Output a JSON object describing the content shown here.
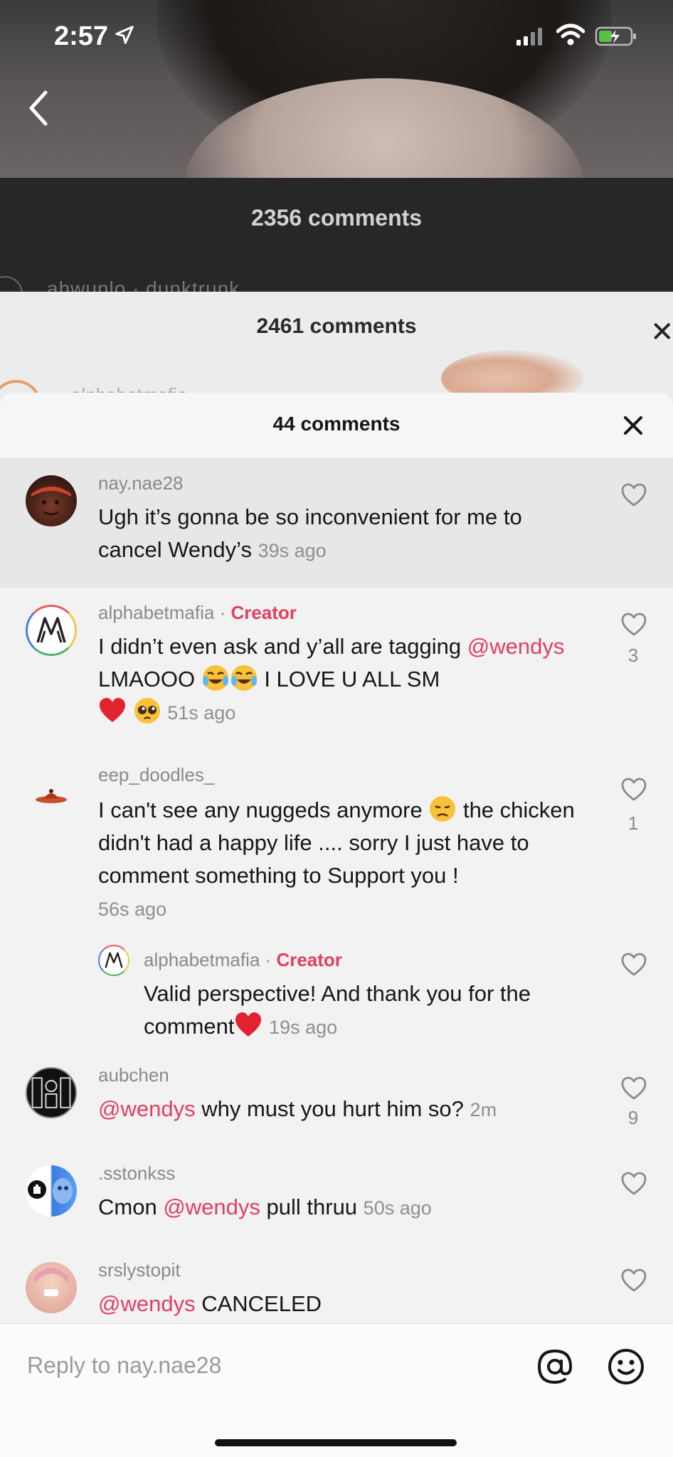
{
  "status_bar": {
    "time": "2:57"
  },
  "layers": {
    "back_title": "2356 comments",
    "back_ghost": "ahwunlo · dunktrunk",
    "mid_title": "2461 comments",
    "mid_ghost": "alphabetmafia"
  },
  "sheet": {
    "title": "44 comments"
  },
  "comments": [
    {
      "username": "nay.nae28",
      "text": "Ugh it’s gonna be so inconvenient for me to cancel Wendy’s",
      "time": "39s ago",
      "likes": ""
    },
    {
      "username": "alphabetmafia",
      "badge": "Creator",
      "text_pre": "I didn’t even ask and y’all are tagging ",
      "mention": "@wendys",
      "text_post": " LMAOOO",
      "text_post2": " I LOVE U ALL SM",
      "time": "51s ago",
      "likes": "3"
    },
    {
      "username": "eep_doodles_",
      "text_pre": "I can't see any nuggeds anymore",
      "text_post": " the chicken didn't had a happy life .... sorry I just have to comment something to Support you !",
      "time": "56s ago",
      "likes": "1"
    },
    {
      "username": "alphabetmafia",
      "badge": "Creator",
      "text": "Valid perspective! And thank you for the comment",
      "time": "19s ago",
      "likes": ""
    },
    {
      "username": "aubchen",
      "mention": "@wendys",
      "text": " why must you hurt him so?",
      "time": "2m",
      "likes": "9"
    },
    {
      "username": ".sstonkss",
      "text_pre": "Cmon ",
      "mention": "@wendys",
      "text_post": " pull thruu",
      "time": "50s ago",
      "likes": ""
    },
    {
      "username": "srslystopit",
      "mention": "@wendys",
      "text": " CANCELED",
      "likes": ""
    }
  ],
  "reply": {
    "placeholder": "Reply to nay.nae28"
  },
  "colors": {
    "accent": "#e0405f",
    "sheet_bg": "#f2f2f3"
  }
}
